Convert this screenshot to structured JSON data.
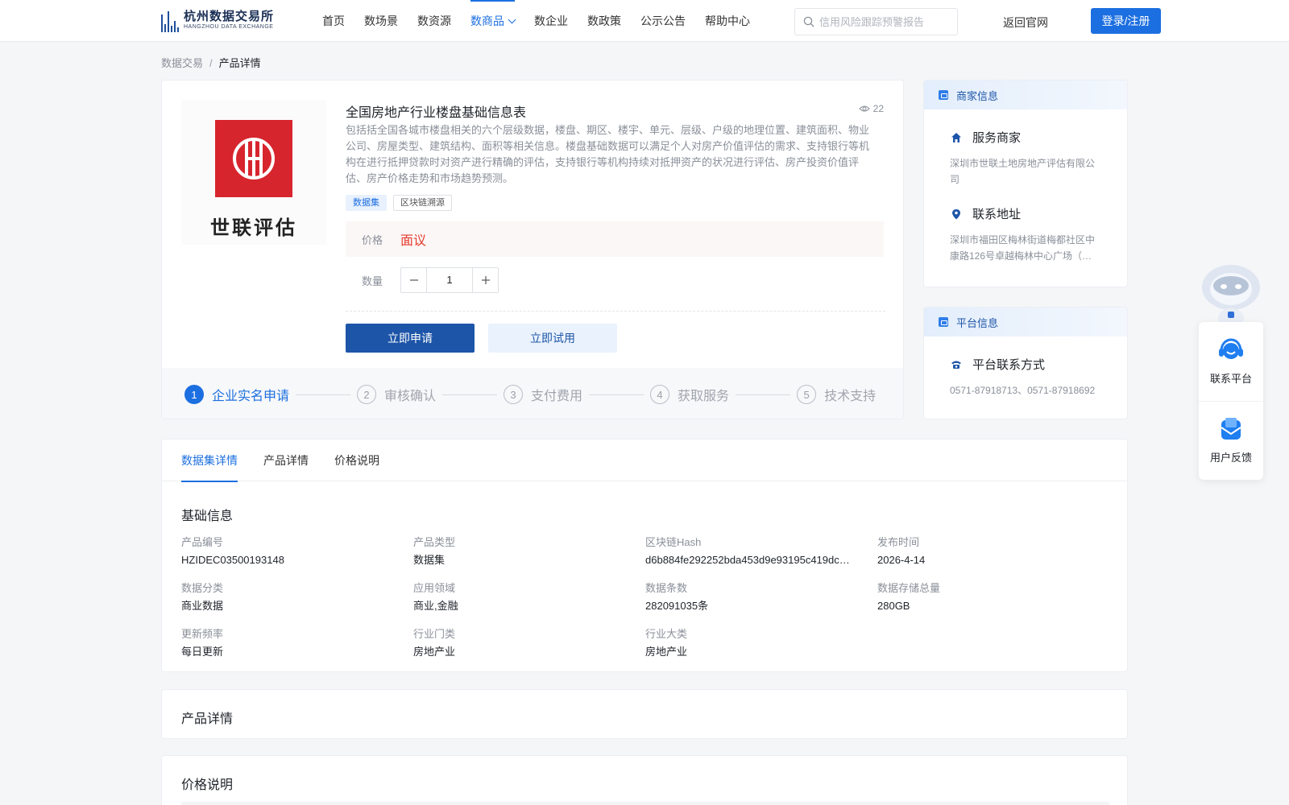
{
  "header": {
    "logo_cn": "杭州数据交易所",
    "logo_en": "HANGZHOU DATA EXCHANGE",
    "nav": [
      {
        "label": "首页"
      },
      {
        "label": "数场景"
      },
      {
        "label": "数资源"
      },
      {
        "label": "数商品"
      },
      {
        "label": "数企业"
      },
      {
        "label": "数政策"
      },
      {
        "label": "公示公告"
      },
      {
        "label": "帮助中心"
      }
    ],
    "active_nav": "数商品",
    "search_placeholder": "信用风险跟踪预警报告",
    "back_label": "返回官网",
    "login_label": "登录/注册"
  },
  "breadcrumb": {
    "root": "数据交易",
    "sep": "/",
    "current": "产品详情"
  },
  "product": {
    "logo_text": "世联评估",
    "title": "全国房地产行业楼盘基础信息表",
    "views": "22",
    "description": "包括括全国各城市楼盘相关的六个层级数据，楼盘、期区、楼宇、单元、层级、户级的地理位置、建筑面积、物业公司、房屋类型、建筑结构、面积等相关信息。楼盘基础数据可以满足个人对房产价值评估的需求、支持银行等机构在进行抵押贷款时对资产进行精确的评估，支持银行等机构持续对抵押资产的状况进行评估、房产投资价值评估、房产价格走势和市场趋势预测。",
    "tags": [
      "数据集",
      "区块链溯源"
    ],
    "price_label": "价格",
    "price_value": "面议",
    "qty_label": "数量",
    "qty_value": "1",
    "apply_label": "立即申请",
    "trial_label": "立即试用"
  },
  "steps": [
    {
      "num": "1",
      "label": "企业实名申请"
    },
    {
      "num": "2",
      "label": "审核确认"
    },
    {
      "num": "3",
      "label": "支付费用"
    },
    {
      "num": "4",
      "label": "获取服务"
    },
    {
      "num": "5",
      "label": "技术支持"
    }
  ],
  "merchant": {
    "head": "商家信息",
    "service_title": "服务商家",
    "service_value": "深圳市世联土地房地产评估有限公司",
    "address_title": "联系地址",
    "address_value": "深圳市福田区梅林街道梅都社区中康路126号卓越梅林中心广场（…"
  },
  "platform": {
    "head": "平台信息",
    "contact_title": "平台联系方式",
    "contact_value": "0571-87918713、0571-87918692"
  },
  "tabs": [
    "数据集详情",
    "产品详情",
    "价格说明"
  ],
  "basic_info": {
    "title": "基础信息",
    "fields": [
      {
        "label": "产品编号",
        "value": "HZIDEC03500193148"
      },
      {
        "label": "产品类型",
        "value": "数据集"
      },
      {
        "label": "区块链Hash",
        "value": "d6b884fe292252bda453d9e93195c419dc…"
      },
      {
        "label": "发布时间",
        "value": "2026-4-14"
      },
      {
        "label": "数据分类",
        "value": "商业数据"
      },
      {
        "label": "应用领域",
        "value": "商业,金融"
      },
      {
        "label": "数据条数",
        "value": "282091035条"
      },
      {
        "label": "数据存储总量",
        "value": "280GB"
      },
      {
        "label": "更新频率",
        "value": "每日更新"
      },
      {
        "label": "行业门类",
        "value": "房地产业"
      },
      {
        "label": "行业大类",
        "value": "房地产业"
      }
    ]
  },
  "product_detail_title": "产品详情",
  "price_note_title": "价格说明",
  "float": {
    "contact_label": "联系平台",
    "feedback_label": "用户反馈"
  },
  "colors": {
    "primary": "#1c6fe0",
    "dark_primary": "#1d55a8",
    "price": "#e63b2e",
    "logo_red": "#d7252e"
  }
}
